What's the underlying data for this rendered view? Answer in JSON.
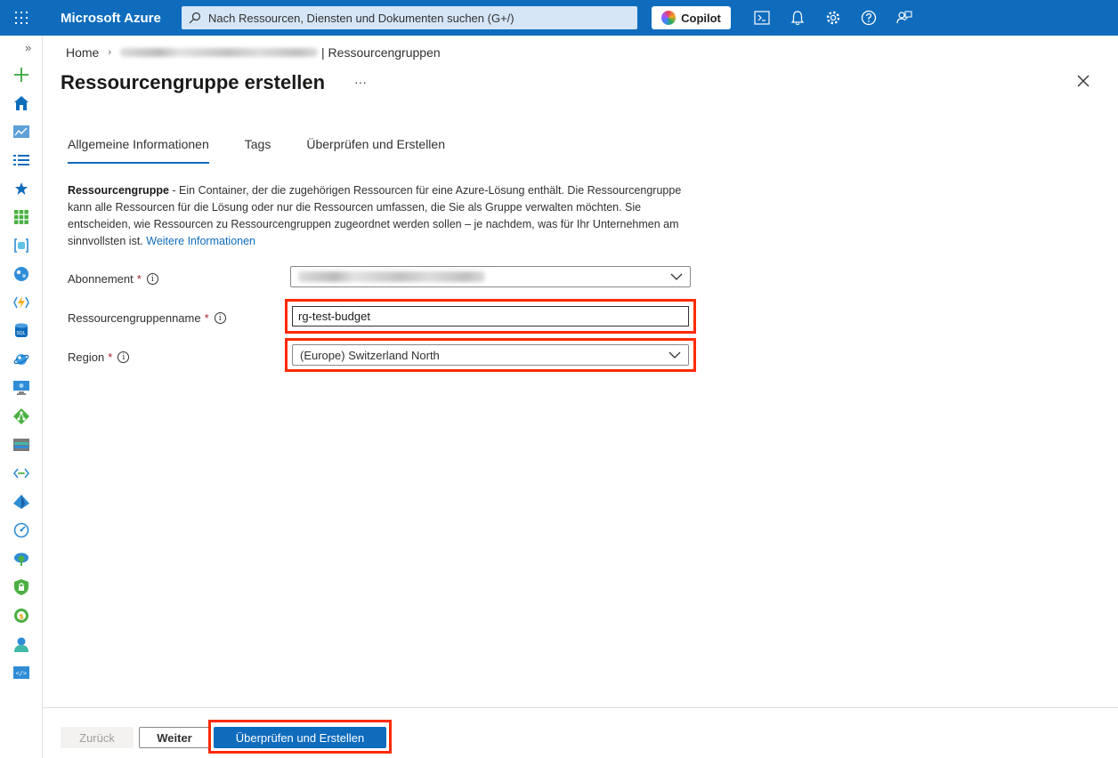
{
  "topbar": {
    "brand": "Microsoft Azure",
    "search_placeholder": "Nach Ressourcen, Diensten und Dokumenten suchen (G+/)",
    "copilot_label": "Copilot",
    "background": "#0f6cbd"
  },
  "breadcrumb": {
    "home": "Home",
    "current": "| Ressourcengruppen"
  },
  "page": {
    "title": "Ressourcengruppe erstellen",
    "more": "···"
  },
  "tabs": [
    {
      "label": "Allgemeine Informationen",
      "active": true
    },
    {
      "label": "Tags",
      "active": false
    },
    {
      "label": "Überprüfen und Erstellen",
      "active": false
    }
  ],
  "description": {
    "term": "Ressourcengruppe",
    "text": " - Ein Container, der die zugehörigen Ressourcen für eine Azure-Lösung enthält. Die Ressourcengruppe kann alle Ressourcen für die Lösung oder nur die Ressourcen umfassen, die Sie als Gruppe verwalten möchten. Sie entscheiden, wie Ressourcen zu Ressourcengruppen zugeordnet werden sollen – je nachdem, was für Ihr Unternehmen am sinnvollsten ist.",
    "link": "Weitere Informationen"
  },
  "form": {
    "subscription": {
      "label": "Abonnement",
      "required": "*"
    },
    "rg_name": {
      "label": "Ressourcengruppenname",
      "required": "*",
      "value": "rg-test-budget"
    },
    "region": {
      "label": "Region",
      "required": "*",
      "value": "(Europe) Switzerland North"
    },
    "info_glyph": "i"
  },
  "footer": {
    "back": "Zurück",
    "next": "Weiter",
    "review": "Überprüfen und Erstellen"
  },
  "highlight_color": "#ff2a00",
  "rail_icons": [
    "expand-icon",
    "create-resource-icon",
    "home-icon",
    "dashboard-icon",
    "all-services-icon",
    "favorites-icon",
    "all-resources-icon",
    "resource-groups-icon",
    "app-services-icon",
    "function-apps-icon",
    "sql-databases-icon",
    "cosmos-db-icon",
    "virtual-machines-icon",
    "load-balancers-icon",
    "storage-accounts-icon",
    "virtual-networks-icon",
    "entra-id-icon",
    "monitor-icon",
    "advisor-icon",
    "defender-icon",
    "cost-management-icon",
    "help-support-icon",
    "devops-icon"
  ]
}
